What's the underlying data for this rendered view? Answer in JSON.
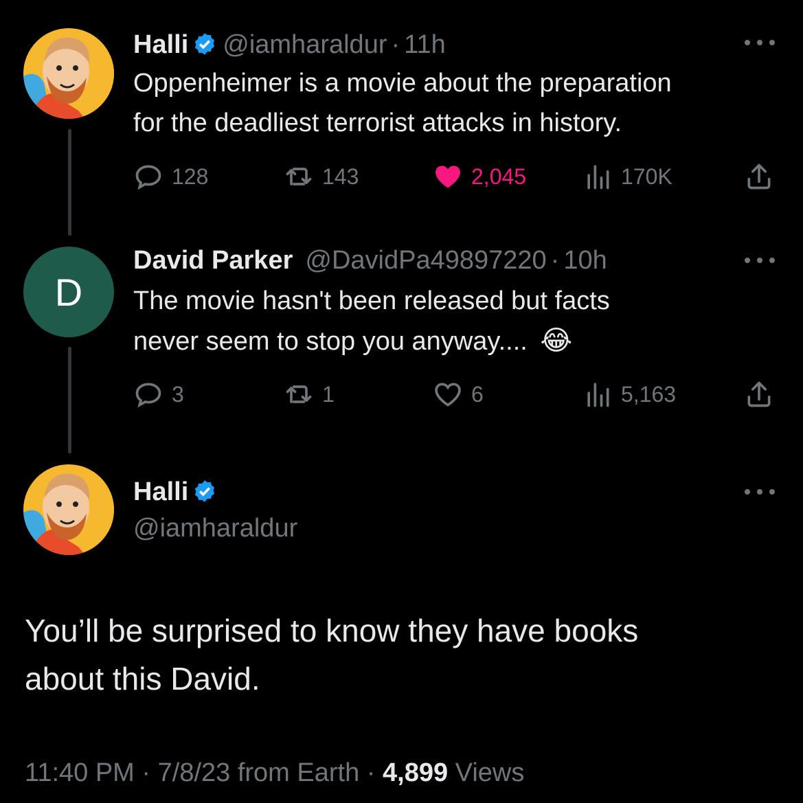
{
  "tweets": [
    {
      "name": "Halli",
      "handle": "@iamharaldur",
      "separator": "·",
      "time": "11h",
      "text_line1": "Oppenheimer is a movie about the preparation",
      "text_line2": "for the deadliest terrorist attacks in history.",
      "replies": "128",
      "retweets": "143",
      "likes": "2,045",
      "views": "170K",
      "liked": true,
      "avatar_icon": "cartoon-bearded-man-avatar"
    },
    {
      "name": "David Parker",
      "handle": "@DavidPa49897220",
      "separator": "·",
      "time": "10h",
      "avatar_letter": "D",
      "text_line1": "The movie hasn't been released but facts",
      "text_line2": "never seem to stop you anyway....",
      "emoji": "😂",
      "replies": "3",
      "retweets": "1",
      "likes": "6",
      "views": "5,163",
      "liked": false
    }
  ],
  "main_tweet": {
    "name": "Halli",
    "handle": "@iamharaldur",
    "text_line1": "You’ll be surprised to know they have books",
    "text_line2": "about this David.",
    "footer_time": "11:40 PM",
    "footer_sep1": "·",
    "footer_date": "7/8/23 from Earth",
    "footer_sep2": "·",
    "views_count": "4,899",
    "views_label": "Views"
  },
  "colors": {
    "background": "#000000",
    "text": "#e7e9ea",
    "muted": "#71767b",
    "like_pink": "#f91880",
    "verified_blue": "#1d9bf0",
    "avatar_d_bg": "#1e5b4a"
  }
}
